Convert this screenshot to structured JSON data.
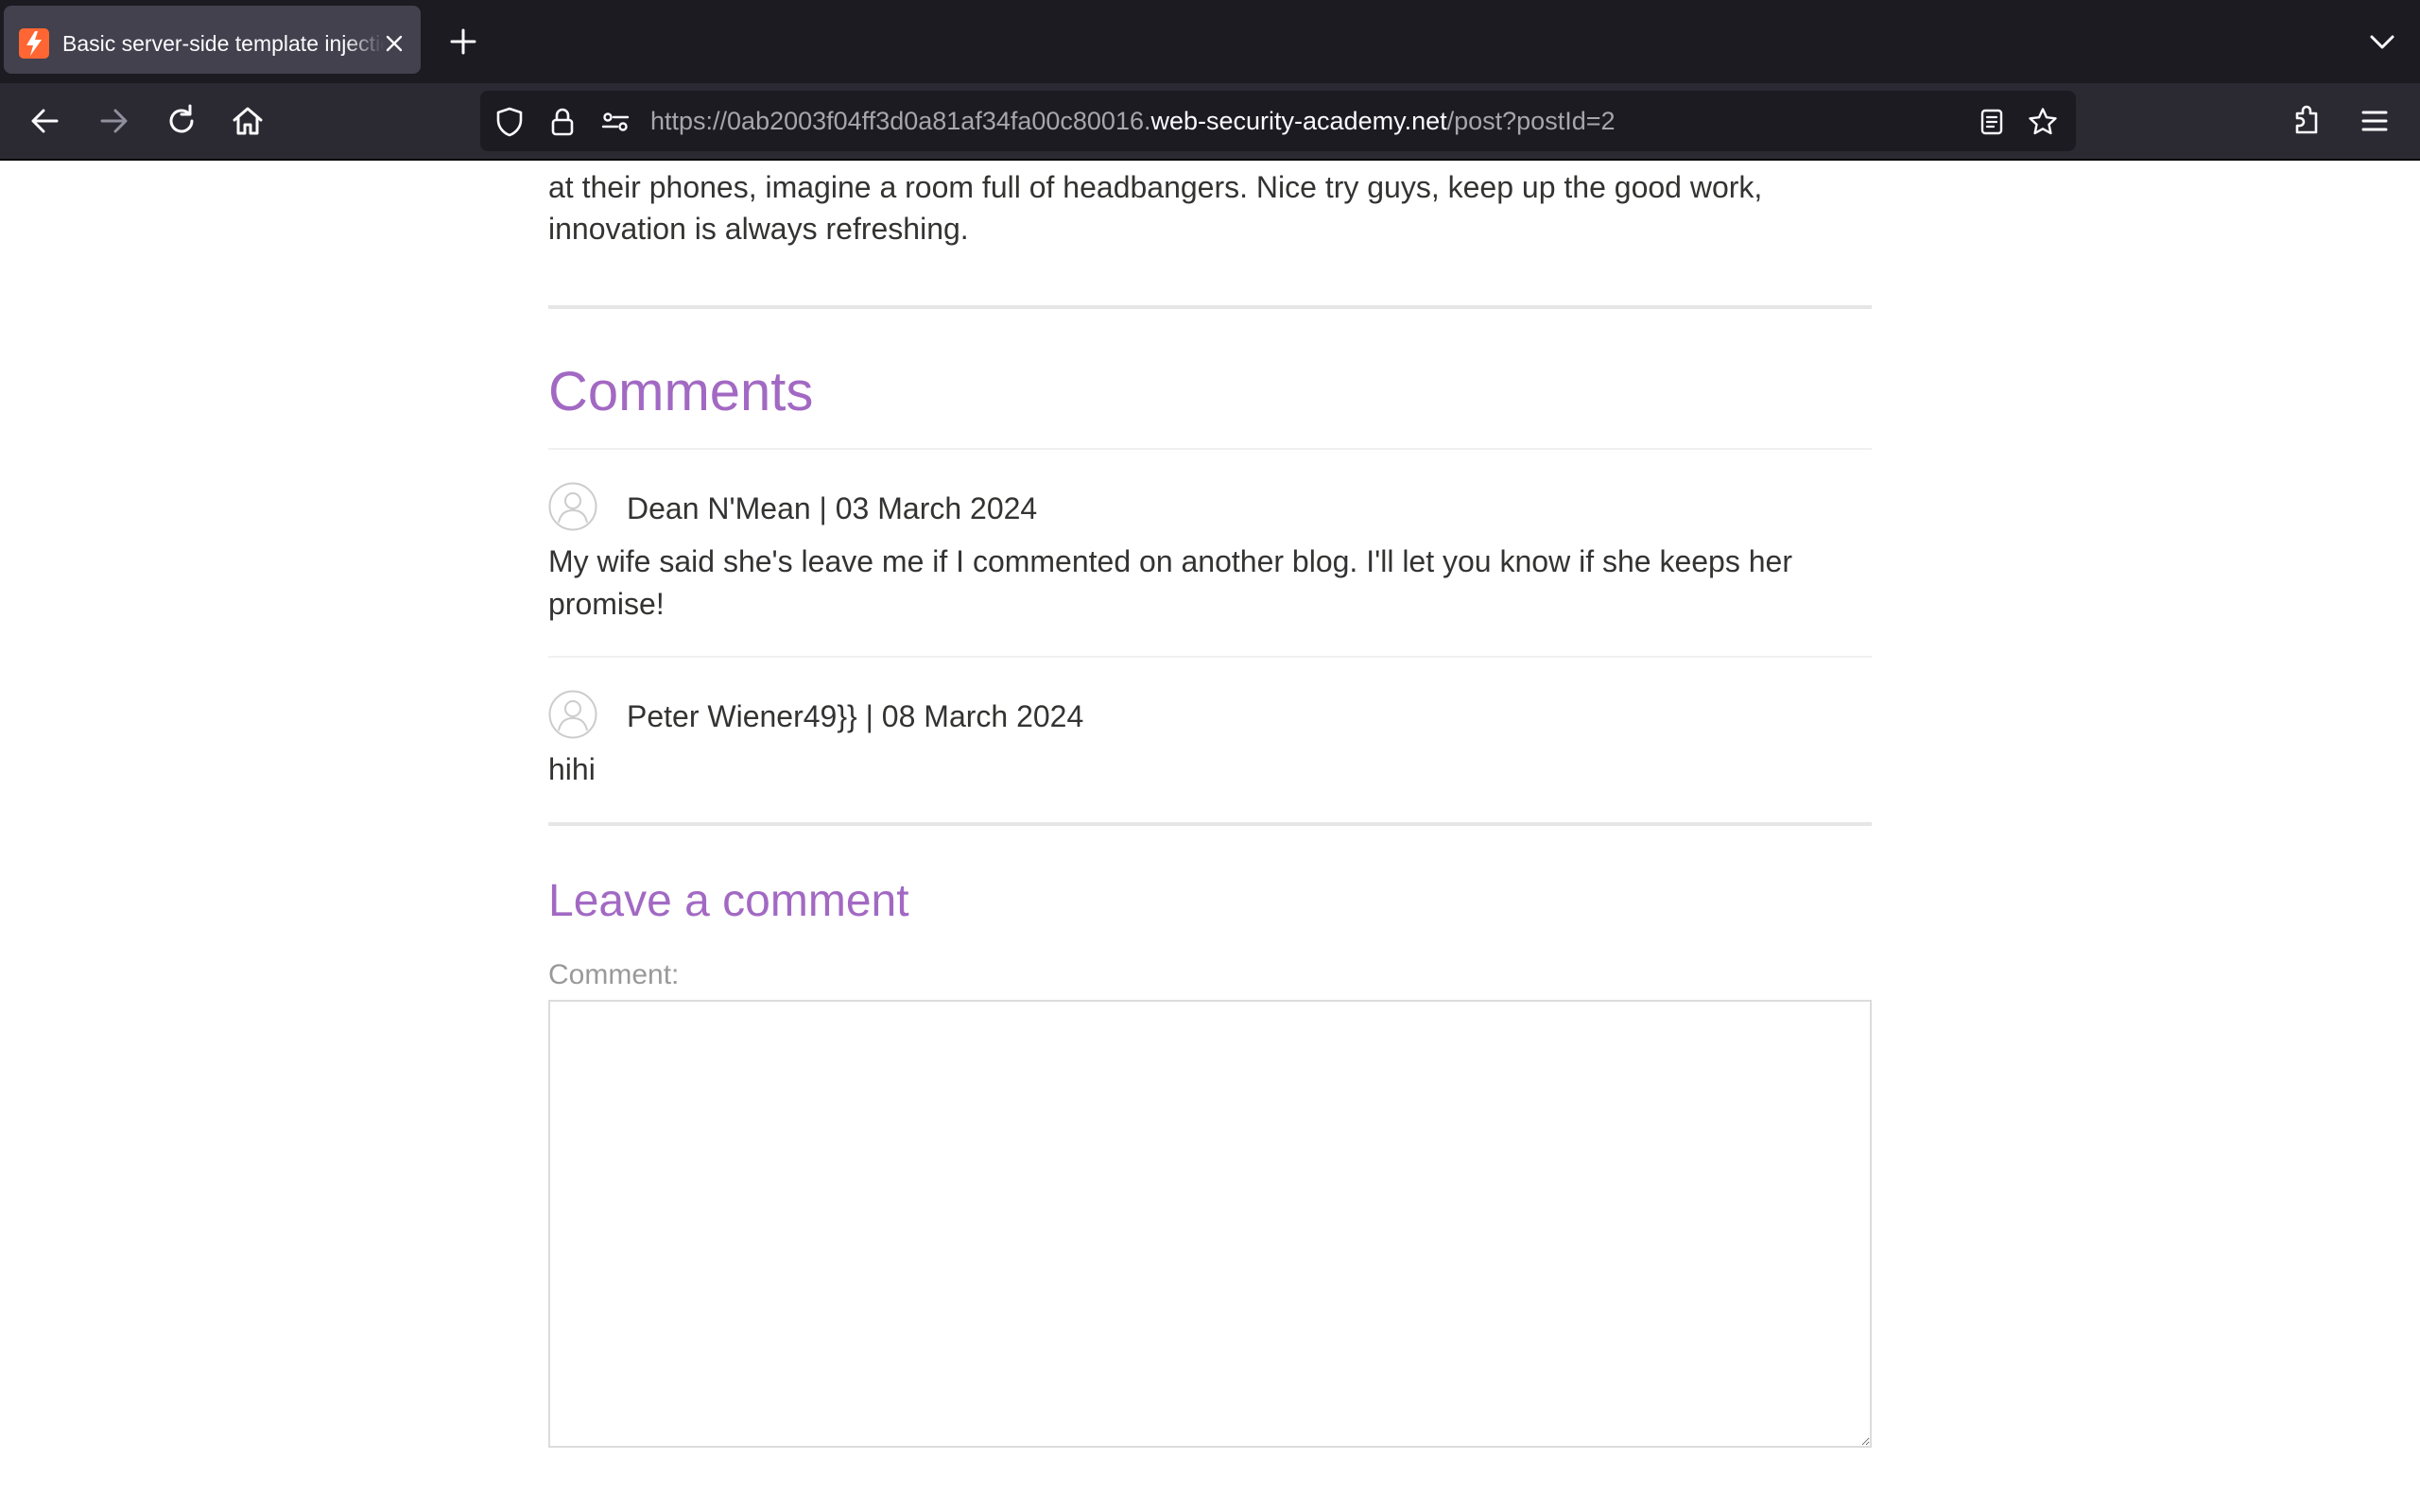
{
  "browser": {
    "tab": {
      "title": "Basic server-side template injection (code context)",
      "favicon": "portswigger-lightning-icon",
      "favicon_color": "#ff6633"
    },
    "url": {
      "prefix": "https://0ab2003f04ff3d0a81af34fa00c80016.",
      "host": "web-security-academy.net",
      "path": "/post?postId=2"
    },
    "chrome_colors": {
      "tabbar": "#1c1b22",
      "active_tab": "#42414d",
      "toolbar": "#2b2a33",
      "urlbar": "#1c1b22"
    }
  },
  "post": {
    "tail_text": "at their phones, imagine a room full of headbangers. Nice try guys, keep up the good work, innovation is always refreshing."
  },
  "comments": {
    "heading": "Comments",
    "items": [
      {
        "author": "Dean N'Mean",
        "date": "03 March 2024",
        "meta": "Dean N'Mean | 03 March 2024",
        "body": "My wife said she's leave me if I commented on another blog. I'll let you know if she keeps her promise!"
      },
      {
        "author": "Peter Wiener49}}",
        "date": "08 March 2024",
        "meta": "Peter Wiener49}} | 08 March 2024",
        "body": "hihi"
      }
    ]
  },
  "leave_comment": {
    "heading": "Leave a comment",
    "label": "Comment:",
    "value": ""
  },
  "theme": {
    "accent": "#a269c3",
    "text": "#333332",
    "muted": "#999999",
    "divider": "#e6e6e6"
  }
}
